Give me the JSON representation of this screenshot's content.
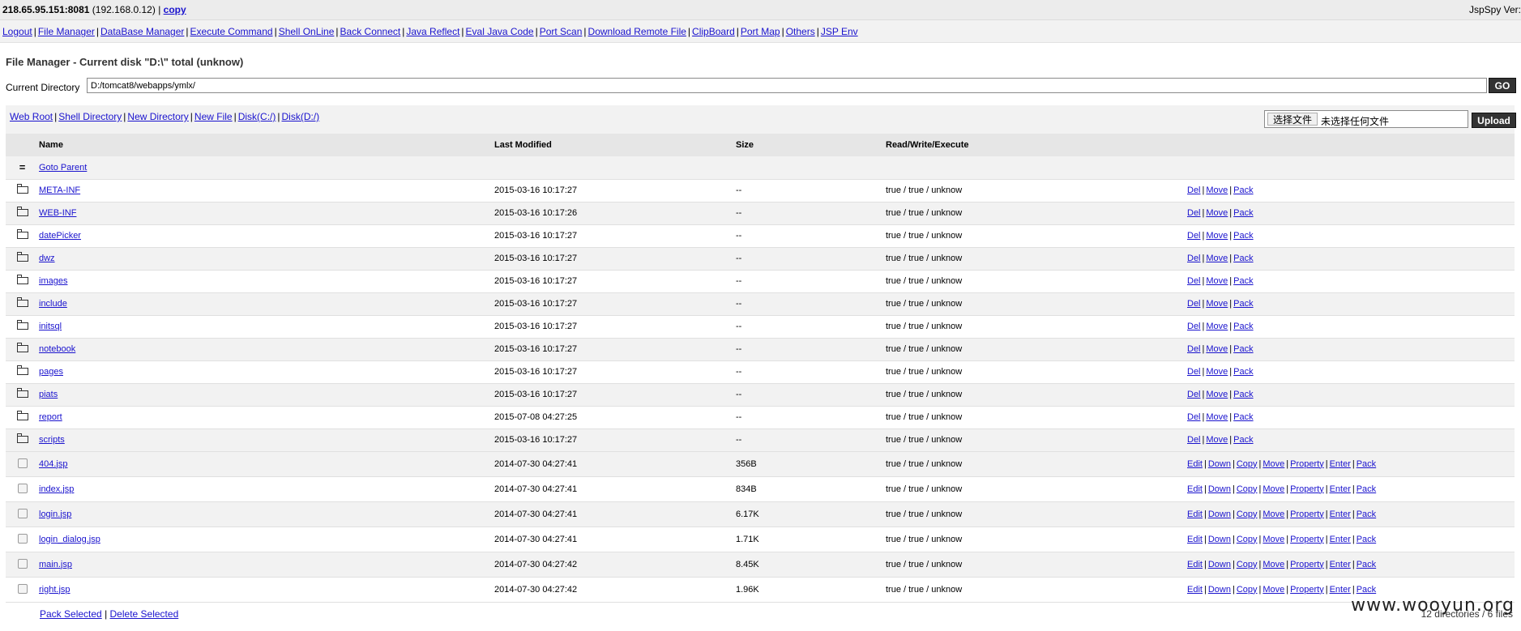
{
  "header": {
    "host": "218.65.95.151:8081",
    "local_ip": "(192.168.0.12)",
    "copy_label": "copy",
    "version_label": "JspSpy Ver:"
  },
  "nav": [
    "Logout",
    "File Manager",
    "DataBase Manager",
    "Execute Command",
    "Shell OnLine",
    "Back Connect",
    "Java Reflect",
    "Eval Java Code",
    "Port Scan",
    "Download Remote File",
    "ClipBoard",
    "Port Map",
    "Others",
    "JSP Env"
  ],
  "title": "File Manager - Current disk \"D:\\\" total (unknow)",
  "directory": {
    "label": "Current Directory",
    "value": "D:/tomcat8/webapps/ymlx/",
    "go_label": "GO"
  },
  "toolbar": {
    "links": [
      "Web Root",
      "Shell Directory",
      "New Directory",
      "New File",
      "Disk(C:/)",
      "Disk(D:/)"
    ],
    "choose_file": "选择文件",
    "no_file": "未选择任何文件",
    "upload_label": "Upload"
  },
  "columns": [
    "Name",
    "Last Modified",
    "Size",
    "Read/Write/Execute"
  ],
  "parent": {
    "icon": "=",
    "label": "Goto Parent"
  },
  "directories": [
    {
      "name": "META-INF",
      "modified": "2015-03-16 10:17:27",
      "size": "--",
      "rwx": "true / true / unknow"
    },
    {
      "name": "WEB-INF",
      "modified": "2015-03-16 10:17:26",
      "size": "--",
      "rwx": "true / true / unknow"
    },
    {
      "name": "datePicker",
      "modified": "2015-03-16 10:17:27",
      "size": "--",
      "rwx": "true / true / unknow"
    },
    {
      "name": "dwz",
      "modified": "2015-03-16 10:17:27",
      "size": "--",
      "rwx": "true / true / unknow"
    },
    {
      "name": "images",
      "modified": "2015-03-16 10:17:27",
      "size": "--",
      "rwx": "true / true / unknow"
    },
    {
      "name": "include",
      "modified": "2015-03-16 10:17:27",
      "size": "--",
      "rwx": "true / true / unknow"
    },
    {
      "name": "initsql",
      "modified": "2015-03-16 10:17:27",
      "size": "--",
      "rwx": "true / true / unknow"
    },
    {
      "name": "notebook",
      "modified": "2015-03-16 10:17:27",
      "size": "--",
      "rwx": "true / true / unknow"
    },
    {
      "name": "pages",
      "modified": "2015-03-16 10:17:27",
      "size": "--",
      "rwx": "true / true / unknow"
    },
    {
      "name": "piats",
      "modified": "2015-03-16 10:17:27",
      "size": "--",
      "rwx": "true / true / unknow"
    },
    {
      "name": "report",
      "modified": "2015-07-08 04:27:25",
      "size": "--",
      "rwx": "true / true / unknow"
    },
    {
      "name": "scripts",
      "modified": "2015-03-16 10:17:27",
      "size": "--",
      "rwx": "true / true / unknow"
    }
  ],
  "dir_actions": [
    "Del",
    "Move",
    "Pack"
  ],
  "files": [
    {
      "name": "404.jsp",
      "modified": "2014-07-30 04:27:41",
      "size": "356B",
      "rwx": "true / true / unknow"
    },
    {
      "name": "index.jsp",
      "modified": "2014-07-30 04:27:41",
      "size": "834B",
      "rwx": "true / true / unknow"
    },
    {
      "name": "login.jsp",
      "modified": "2014-07-30 04:27:41",
      "size": "6.17K",
      "rwx": "true / true / unknow"
    },
    {
      "name": "login_dialog.jsp",
      "modified": "2014-07-30 04:27:41",
      "size": "1.71K",
      "rwx": "true / true / unknow"
    },
    {
      "name": "main.jsp",
      "modified": "2014-07-30 04:27:42",
      "size": "8.45K",
      "rwx": "true / true / unknow"
    },
    {
      "name": "right.jsp",
      "modified": "2014-07-30 04:27:42",
      "size": "1.96K",
      "rwx": "true / true / unknow"
    }
  ],
  "file_actions": [
    "Edit",
    "Down",
    "Copy",
    "Move",
    "Property",
    "Enter",
    "Pack"
  ],
  "footer": {
    "pack_selected": "Pack Selected",
    "delete_selected": "Delete Selected",
    "summary": "12 directories / 6 files"
  },
  "watermark": "www.wooyun.org"
}
